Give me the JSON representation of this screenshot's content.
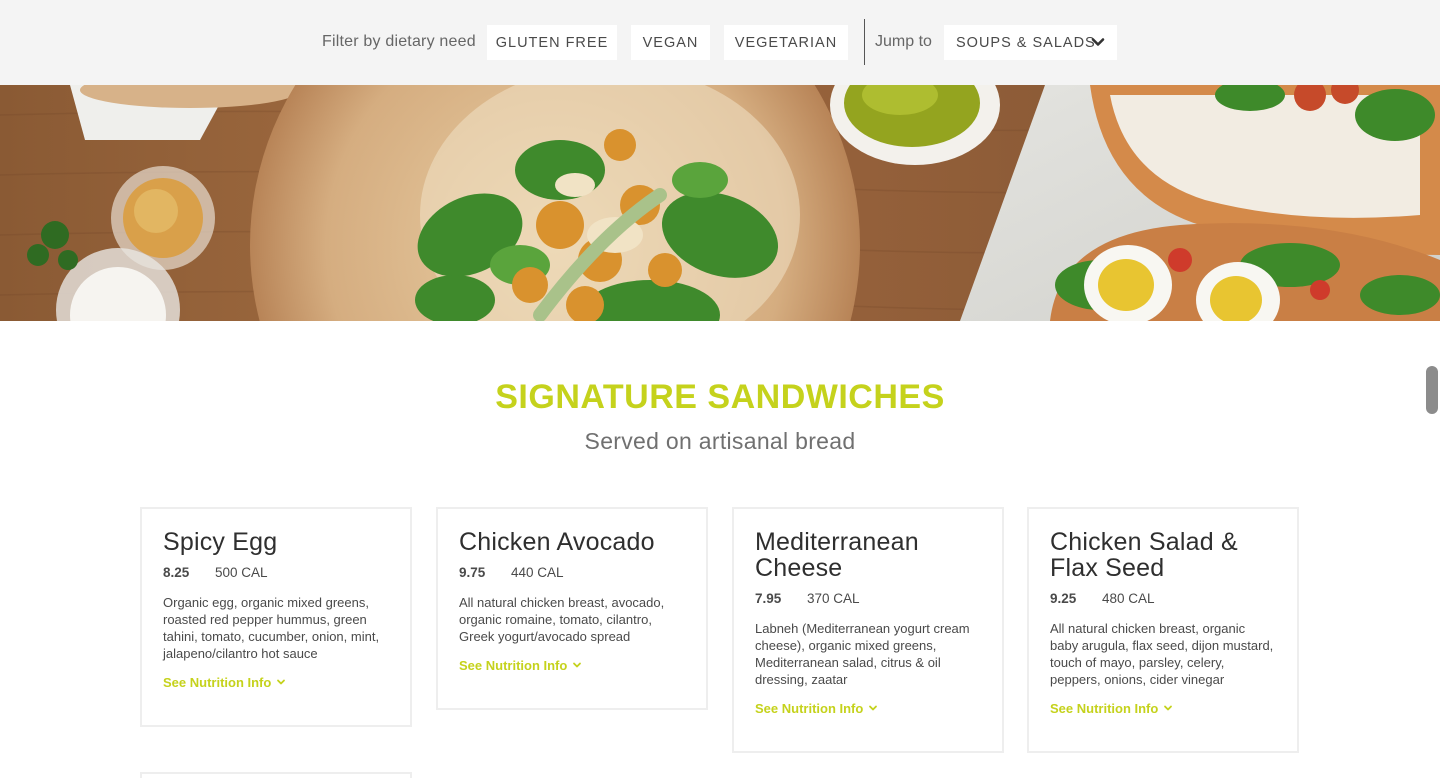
{
  "filter_bar": {
    "label": "Filter by dietary need",
    "chips": [
      "GLUTEN FREE",
      "VEGAN",
      "VEGETARIAN"
    ],
    "jump_label": "Jump to",
    "jump_selected": "SOUPS & SALADS"
  },
  "section": {
    "title": "SIGNATURE SANDWICHES",
    "subtitle": "Served on artisanal bread"
  },
  "items": [
    {
      "name": "Spicy Egg",
      "price": "8.25",
      "calories": "500 CAL",
      "description": "Organic egg, organic mixed greens, roasted red pepper hummus, green tahini, tomato, cucumber, onion, mint, jalapeno/cilantro hot sauce",
      "nutrition_link": "See Nutrition Info"
    },
    {
      "name": "Chicken Avocado",
      "price": "9.75",
      "calories": "440 CAL",
      "description": "All natural chicken breast, avocado, organic romaine, tomato, cilantro, Greek yogurt/avocado spread",
      "nutrition_link": "See Nutrition Info"
    },
    {
      "name": "Mediterranean Cheese",
      "price": "7.95",
      "calories": "370 CAL",
      "description": "Labneh (Mediterranean yogurt cream cheese), organic mixed greens, Mediterranean salad, citrus & oil dressing, zaatar",
      "nutrition_link": "See Nutrition Info"
    },
    {
      "name": "Chicken Salad & Flax Seed",
      "price": "9.25",
      "calories": "480 CAL",
      "description": "All natural chicken breast, organic baby arugula, flax seed, dijon mustard, touch of mayo, parsley, celery, peppers, onions, cider vinegar",
      "nutrition_link": "See Nutrition Info"
    }
  ],
  "colors": {
    "accent": "#c5d21c",
    "filter_bar_bg": "#f4f4f4",
    "card_border": "#eeeeee"
  },
  "icons": {
    "jump_chevron": "chevron-down-icon",
    "nutrition_chevron": "chevron-down-icon"
  }
}
